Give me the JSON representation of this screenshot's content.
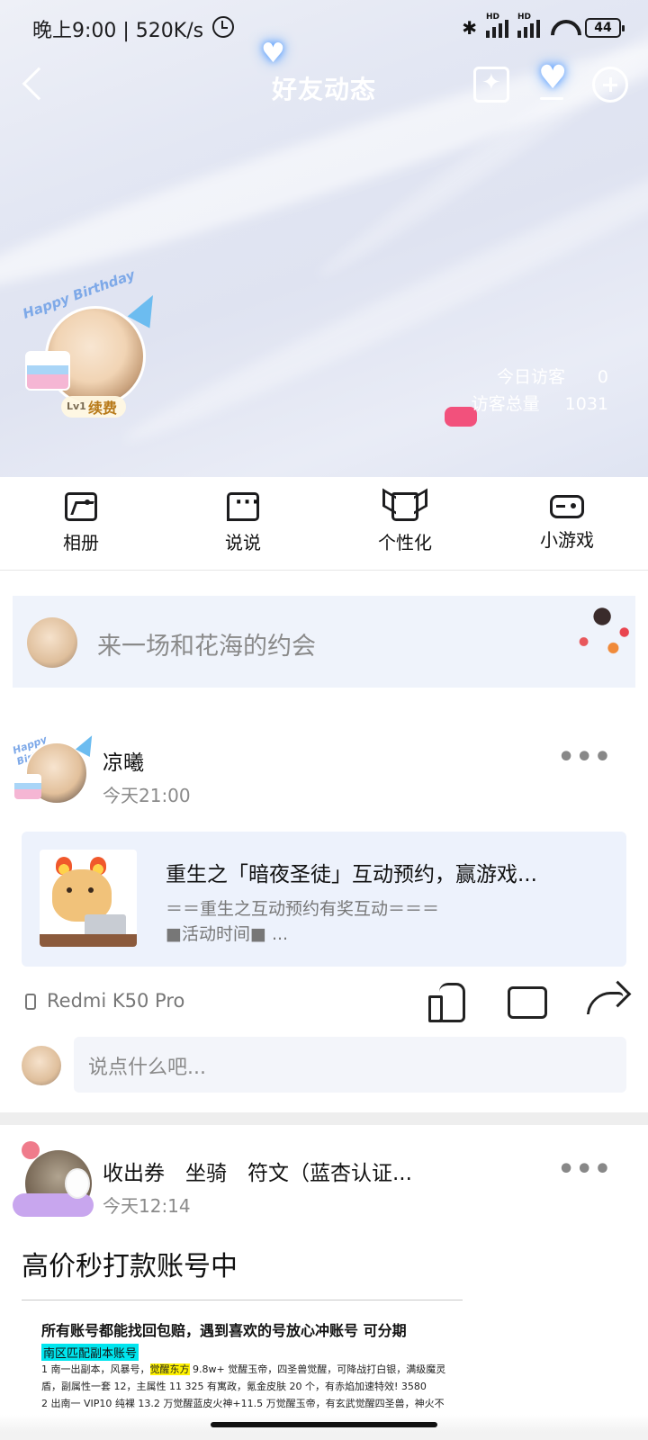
{
  "status_bar": {
    "time": "晚上9:00 | 520K/s",
    "battery": "44",
    "bluetooth": "✱",
    "signal_label_1": "HD",
    "signal_label_2": "HD"
  },
  "nav": {
    "title": "好友动态"
  },
  "profile": {
    "birthday_text": "Happy Birthday",
    "level": "Lv1",
    "renew_label": "续费",
    "today_visitors_label": "今日访客",
    "today_visitors_value": "0",
    "total_visitors_label": "访客总量",
    "total_visitors_value": "1031"
  },
  "toolbar": {
    "items": [
      {
        "label": "相册",
        "icon": "album-icon"
      },
      {
        "label": "说说",
        "icon": "message-icon"
      },
      {
        "label": "个性化",
        "icon": "shirt-icon"
      },
      {
        "label": "小游戏",
        "icon": "gamepad-icon"
      }
    ]
  },
  "compose": {
    "placeholder": "来一场和花海的约会"
  },
  "posts": [
    {
      "author": "凉曦",
      "time": "今天21:00",
      "share": {
        "title": "重生之「暗夜圣徒」互动预约，赢游戏...",
        "desc_line1": "＝＝重生之互动预约有奖互动＝＝＝",
        "desc_line2": "■活动时间■ ..."
      },
      "device": "Redmi K50 Pro",
      "comment_placeholder": "说点什么吧..."
    },
    {
      "author": "收出券　坐骑　符文（蓝杏认证...",
      "time": "今天12:14",
      "text": "高价秒打款账号中",
      "image": {
        "heading": "所有账号都能找回包赔，遇到喜欢的号放心冲账号 可分期",
        "tag": "南区匹配副本账号",
        "line1_a": "1 南一出副本，风暴号，",
        "line1_hl": "觉醒东方",
        "line1_b": " 9.8w+ 觉醒玉帝，四圣兽觉醒，可降战打白银，满级魔灵盾，副属性一套 12，主属性 11 325 有寓政，氪金皮肤 20 个，有赤焰加速特效! 3580",
        "line2": "2 出南一 VIP10 纯裸 13.2 万觉醒蓝皮火神+11.5 万觉醒玉帝，有玄武觉醒四圣兽，神火不"
      }
    }
  ],
  "more_glyph": "•••"
}
